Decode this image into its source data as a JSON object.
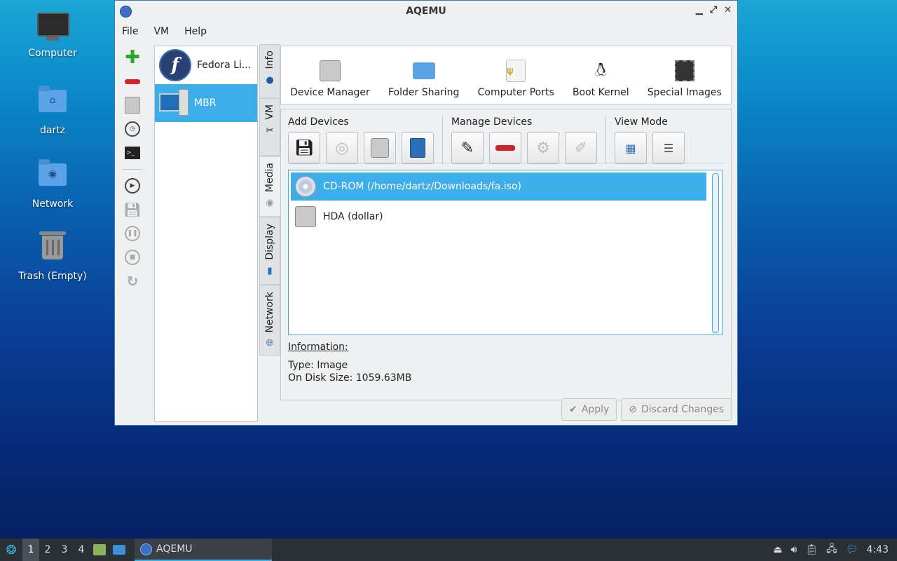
{
  "desktop": {
    "icons": [
      {
        "label": "Computer",
        "icon": "computer-icon"
      },
      {
        "label": "dartz",
        "icon": "home-folder-icon"
      },
      {
        "label": "Network",
        "icon": "network-folder-icon"
      },
      {
        "label": "Trash (Empty)",
        "icon": "trash-icon"
      }
    ]
  },
  "window": {
    "title": "AQEMU",
    "menu": [
      "File",
      "VM",
      "Help"
    ],
    "vm_list": [
      {
        "name": "Fedora Li...",
        "icon": "fedora-icon"
      },
      {
        "name": "MBR",
        "icon": "computer-icon",
        "selected": true
      }
    ],
    "tabs": [
      {
        "label": "Info",
        "icon": "info-icon"
      },
      {
        "label": "VM",
        "icon": "tools-icon"
      },
      {
        "label": "Media",
        "icon": "disc-icon",
        "active": true
      },
      {
        "label": "Display",
        "icon": "display-icon"
      },
      {
        "label": "Network",
        "icon": "network-icon"
      }
    ],
    "top_buttons": [
      {
        "label": "Device Manager",
        "icon": "harddisk-icon"
      },
      {
        "label": "Folder Sharing",
        "icon": "folder-icon"
      },
      {
        "label": "Computer Ports",
        "icon": "usb-icon"
      },
      {
        "label": "Boot Kernel",
        "icon": "tux-icon"
      },
      {
        "label": "Special Images",
        "icon": "chip-icon"
      }
    ],
    "groups": {
      "add": "Add Devices",
      "manage": "Manage Devices",
      "view": "View Mode"
    },
    "devices": [
      {
        "label": "CD-ROM (/home/dartz/Downloads/fa.iso)",
        "icon": "cdrom-icon",
        "selected": true
      },
      {
        "label": "HDA (dollar)",
        "icon": "harddisk-icon"
      }
    ],
    "info": {
      "heading": "Information:",
      "type": "Type: Image",
      "size": "On Disk Size: 1059.63MB"
    },
    "buttons": {
      "apply": "Apply",
      "discard": "Discard Changes"
    }
  },
  "taskbar": {
    "workspaces": [
      "1",
      "2",
      "3",
      "4"
    ],
    "app": "AQEMU",
    "clock": "4:43"
  }
}
